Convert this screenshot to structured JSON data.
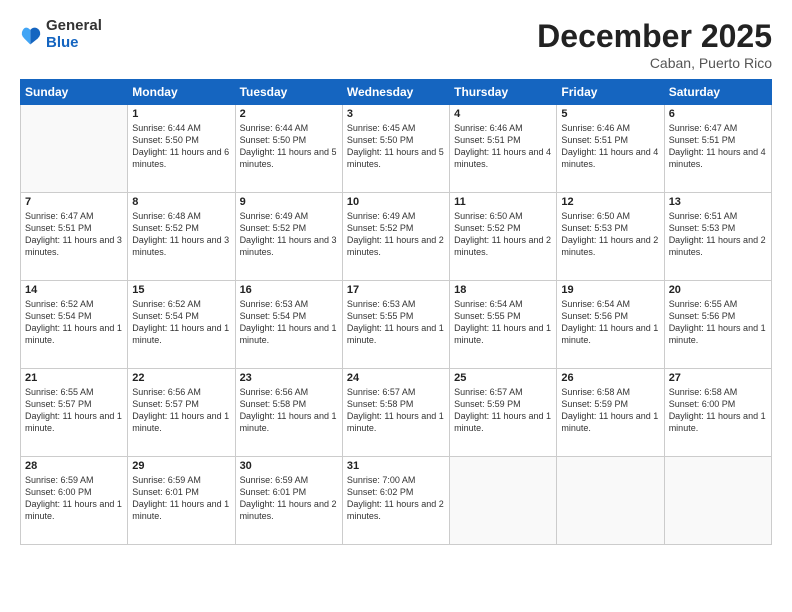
{
  "logo": {
    "general": "General",
    "blue": "Blue"
  },
  "header": {
    "month": "December 2025",
    "location": "Caban, Puerto Rico"
  },
  "weekdays": [
    "Sunday",
    "Monday",
    "Tuesday",
    "Wednesday",
    "Thursday",
    "Friday",
    "Saturday"
  ],
  "weeks": [
    [
      {
        "day": "",
        "sunrise": "",
        "sunset": "",
        "daylight": ""
      },
      {
        "day": "1",
        "sunrise": "Sunrise: 6:44 AM",
        "sunset": "Sunset: 5:50 PM",
        "daylight": "Daylight: 11 hours and 6 minutes."
      },
      {
        "day": "2",
        "sunrise": "Sunrise: 6:44 AM",
        "sunset": "Sunset: 5:50 PM",
        "daylight": "Daylight: 11 hours and 5 minutes."
      },
      {
        "day": "3",
        "sunrise": "Sunrise: 6:45 AM",
        "sunset": "Sunset: 5:50 PM",
        "daylight": "Daylight: 11 hours and 5 minutes."
      },
      {
        "day": "4",
        "sunrise": "Sunrise: 6:46 AM",
        "sunset": "Sunset: 5:51 PM",
        "daylight": "Daylight: 11 hours and 4 minutes."
      },
      {
        "day": "5",
        "sunrise": "Sunrise: 6:46 AM",
        "sunset": "Sunset: 5:51 PM",
        "daylight": "Daylight: 11 hours and 4 minutes."
      },
      {
        "day": "6",
        "sunrise": "Sunrise: 6:47 AM",
        "sunset": "Sunset: 5:51 PM",
        "daylight": "Daylight: 11 hours and 4 minutes."
      }
    ],
    [
      {
        "day": "7",
        "sunrise": "Sunrise: 6:47 AM",
        "sunset": "Sunset: 5:51 PM",
        "daylight": "Daylight: 11 hours and 3 minutes."
      },
      {
        "day": "8",
        "sunrise": "Sunrise: 6:48 AM",
        "sunset": "Sunset: 5:52 PM",
        "daylight": "Daylight: 11 hours and 3 minutes."
      },
      {
        "day": "9",
        "sunrise": "Sunrise: 6:49 AM",
        "sunset": "Sunset: 5:52 PM",
        "daylight": "Daylight: 11 hours and 3 minutes."
      },
      {
        "day": "10",
        "sunrise": "Sunrise: 6:49 AM",
        "sunset": "Sunset: 5:52 PM",
        "daylight": "Daylight: 11 hours and 2 minutes."
      },
      {
        "day": "11",
        "sunrise": "Sunrise: 6:50 AM",
        "sunset": "Sunset: 5:52 PM",
        "daylight": "Daylight: 11 hours and 2 minutes."
      },
      {
        "day": "12",
        "sunrise": "Sunrise: 6:50 AM",
        "sunset": "Sunset: 5:53 PM",
        "daylight": "Daylight: 11 hours and 2 minutes."
      },
      {
        "day": "13",
        "sunrise": "Sunrise: 6:51 AM",
        "sunset": "Sunset: 5:53 PM",
        "daylight": "Daylight: 11 hours and 2 minutes."
      }
    ],
    [
      {
        "day": "14",
        "sunrise": "Sunrise: 6:52 AM",
        "sunset": "Sunset: 5:54 PM",
        "daylight": "Daylight: 11 hours and 1 minute."
      },
      {
        "day": "15",
        "sunrise": "Sunrise: 6:52 AM",
        "sunset": "Sunset: 5:54 PM",
        "daylight": "Daylight: 11 hours and 1 minute."
      },
      {
        "day": "16",
        "sunrise": "Sunrise: 6:53 AM",
        "sunset": "Sunset: 5:54 PM",
        "daylight": "Daylight: 11 hours and 1 minute."
      },
      {
        "day": "17",
        "sunrise": "Sunrise: 6:53 AM",
        "sunset": "Sunset: 5:55 PM",
        "daylight": "Daylight: 11 hours and 1 minute."
      },
      {
        "day": "18",
        "sunrise": "Sunrise: 6:54 AM",
        "sunset": "Sunset: 5:55 PM",
        "daylight": "Daylight: 11 hours and 1 minute."
      },
      {
        "day": "19",
        "sunrise": "Sunrise: 6:54 AM",
        "sunset": "Sunset: 5:56 PM",
        "daylight": "Daylight: 11 hours and 1 minute."
      },
      {
        "day": "20",
        "sunrise": "Sunrise: 6:55 AM",
        "sunset": "Sunset: 5:56 PM",
        "daylight": "Daylight: 11 hours and 1 minute."
      }
    ],
    [
      {
        "day": "21",
        "sunrise": "Sunrise: 6:55 AM",
        "sunset": "Sunset: 5:57 PM",
        "daylight": "Daylight: 11 hours and 1 minute."
      },
      {
        "day": "22",
        "sunrise": "Sunrise: 6:56 AM",
        "sunset": "Sunset: 5:57 PM",
        "daylight": "Daylight: 11 hours and 1 minute."
      },
      {
        "day": "23",
        "sunrise": "Sunrise: 6:56 AM",
        "sunset": "Sunset: 5:58 PM",
        "daylight": "Daylight: 11 hours and 1 minute."
      },
      {
        "day": "24",
        "sunrise": "Sunrise: 6:57 AM",
        "sunset": "Sunset: 5:58 PM",
        "daylight": "Daylight: 11 hours and 1 minute."
      },
      {
        "day": "25",
        "sunrise": "Sunrise: 6:57 AM",
        "sunset": "Sunset: 5:59 PM",
        "daylight": "Daylight: 11 hours and 1 minute."
      },
      {
        "day": "26",
        "sunrise": "Sunrise: 6:58 AM",
        "sunset": "Sunset: 5:59 PM",
        "daylight": "Daylight: 11 hours and 1 minute."
      },
      {
        "day": "27",
        "sunrise": "Sunrise: 6:58 AM",
        "sunset": "Sunset: 6:00 PM",
        "daylight": "Daylight: 11 hours and 1 minute."
      }
    ],
    [
      {
        "day": "28",
        "sunrise": "Sunrise: 6:59 AM",
        "sunset": "Sunset: 6:00 PM",
        "daylight": "Daylight: 11 hours and 1 minute."
      },
      {
        "day": "29",
        "sunrise": "Sunrise: 6:59 AM",
        "sunset": "Sunset: 6:01 PM",
        "daylight": "Daylight: 11 hours and 1 minute."
      },
      {
        "day": "30",
        "sunrise": "Sunrise: 6:59 AM",
        "sunset": "Sunset: 6:01 PM",
        "daylight": "Daylight: 11 hours and 2 minutes."
      },
      {
        "day": "31",
        "sunrise": "Sunrise: 7:00 AM",
        "sunset": "Sunset: 6:02 PM",
        "daylight": "Daylight: 11 hours and 2 minutes."
      },
      {
        "day": "",
        "sunrise": "",
        "sunset": "",
        "daylight": ""
      },
      {
        "day": "",
        "sunrise": "",
        "sunset": "",
        "daylight": ""
      },
      {
        "day": "",
        "sunrise": "",
        "sunset": "",
        "daylight": ""
      }
    ]
  ]
}
